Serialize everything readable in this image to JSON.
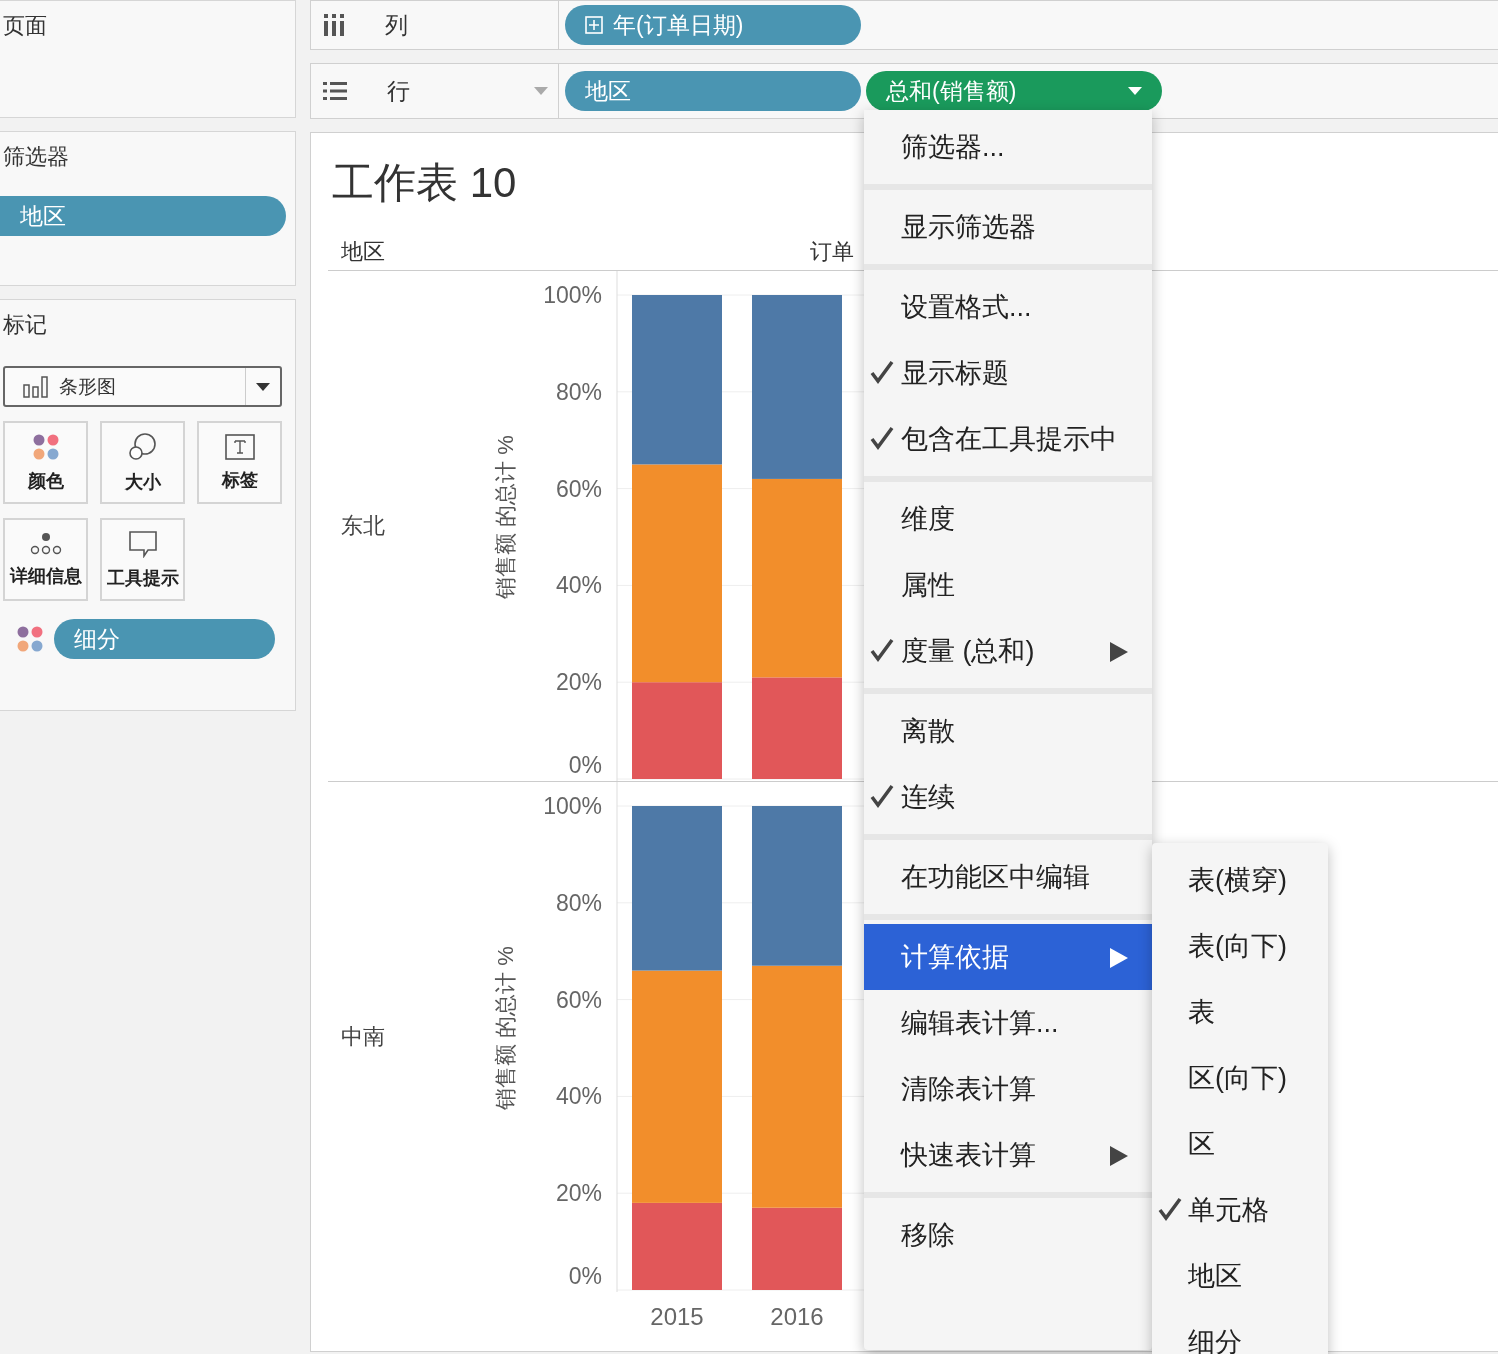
{
  "sidebar": {
    "pages": {
      "title": "页面"
    },
    "filters": {
      "title": "筛选器",
      "pills": [
        "地区"
      ]
    },
    "marks": {
      "title": "标记",
      "mark_type": "条形图",
      "cards": [
        {
          "label": "颜色",
          "kind": "color"
        },
        {
          "label": "大小",
          "kind": "size"
        },
        {
          "label": "标签",
          "kind": "label"
        },
        {
          "label": "详细信息",
          "kind": "detail"
        },
        {
          "label": "工具提示",
          "kind": "tooltip"
        }
      ],
      "fields": [
        {
          "kind": "color",
          "pill": "细分"
        }
      ]
    }
  },
  "shelves": [
    {
      "kind": "columns",
      "label": "列",
      "pills": [
        {
          "text": "年(订单日期)",
          "kind": "dimension",
          "expandable": true
        }
      ]
    },
    {
      "kind": "rows",
      "label": "行",
      "pills": [
        {
          "text": "地区",
          "kind": "dimension",
          "expandable": false
        },
        {
          "text": "总和(销售额)",
          "kind": "measure",
          "expandable": false
        }
      ]
    }
  ],
  "sheet": {
    "title": "工作表 10",
    "headers": [
      "地区",
      "订单"
    ],
    "panes": [
      {
        "region": "东北",
        "chart_data": {
          "type": "bar",
          "stacked": true,
          "ylabel": "销售额 的总计 %",
          "ylim": [
            0,
            1
          ],
          "yticks": [
            {
              "value": 0,
              "label": "0%"
            },
            {
              "value": 0.2,
              "label": "20%"
            },
            {
              "value": 0.4,
              "label": "40%"
            },
            {
              "value": 0.6,
              "label": "60%"
            },
            {
              "value": 0.8,
              "label": "80%"
            },
            {
              "value": 1,
              "label": "100%"
            }
          ],
          "grid": true,
          "series": [
            {
              "color": "#e15759",
              "values": [
                0.2,
                0.21
              ]
            },
            {
              "color": "#f28e2b",
              "values": [
                0.45,
                0.41
              ]
            },
            {
              "color": "#4e79a7",
              "values": [
                0.35,
                0.38
              ]
            }
          ]
        }
      },
      {
        "region": "中南",
        "chart_data": {
          "type": "bar",
          "stacked": true,
          "ylabel": "销售额 的总计 %",
          "categories": [
            "2015",
            "2016"
          ],
          "ylim": [
            0,
            1
          ],
          "yticks": [
            {
              "value": 0,
              "label": "0%"
            },
            {
              "value": 0.2,
              "label": "20%"
            },
            {
              "value": 0.4,
              "label": "40%"
            },
            {
              "value": 0.6,
              "label": "60%"
            },
            {
              "value": 0.8,
              "label": "80%"
            },
            {
              "value": 1,
              "label": "100%"
            }
          ],
          "grid": true,
          "series": [
            {
              "color": "#e15759",
              "values": [
                0.18,
                0.17
              ]
            },
            {
              "color": "#f28e2b",
              "values": [
                0.48,
                0.5
              ]
            },
            {
              "color": "#4e79a7",
              "values": [
                0.34,
                0.33
              ]
            }
          ]
        }
      }
    ]
  },
  "context_menu": {
    "groups": [
      [
        {
          "label": "筛选器...",
          "checked": false,
          "submenu": false,
          "selected": false
        }
      ],
      [
        {
          "label": "显示筛选器",
          "checked": false,
          "submenu": false,
          "selected": false
        }
      ],
      [
        {
          "label": "设置格式...",
          "checked": false,
          "submenu": false,
          "selected": false
        },
        {
          "label": "显示标题",
          "checked": true,
          "submenu": false,
          "selected": false
        },
        {
          "label": "包含在工具提示中",
          "checked": true,
          "submenu": false,
          "selected": false
        }
      ],
      [
        {
          "label": "维度",
          "checked": false,
          "submenu": false,
          "selected": false
        },
        {
          "label": "属性",
          "checked": false,
          "submenu": false,
          "selected": false
        },
        {
          "label": "度量 (总和)",
          "checked": true,
          "submenu": true,
          "selected": false
        }
      ],
      [
        {
          "label": "离散",
          "checked": false,
          "submenu": false,
          "selected": false
        },
        {
          "label": "连续",
          "checked": true,
          "submenu": false,
          "selected": false
        }
      ],
      [
        {
          "label": "在功能区中编辑",
          "checked": false,
          "submenu": false,
          "selected": false
        }
      ],
      [
        {
          "label": "计算依据",
          "checked": false,
          "submenu": true,
          "selected": true
        },
        {
          "label": "编辑表计算...",
          "checked": false,
          "submenu": false,
          "selected": false
        },
        {
          "label": "清除表计算",
          "checked": false,
          "submenu": false,
          "selected": false
        },
        {
          "label": "快速表计算",
          "checked": false,
          "submenu": true,
          "selected": false
        }
      ],
      [
        {
          "label": "移除",
          "checked": false,
          "submenu": false,
          "selected": false
        }
      ]
    ]
  },
  "submenu": {
    "items": [
      {
        "label": "表(横穿)",
        "checked": false
      },
      {
        "label": "表(向下)",
        "checked": false
      },
      {
        "label": "表",
        "checked": false
      },
      {
        "label": "区(向下)",
        "checked": false
      },
      {
        "label": "区",
        "checked": false
      },
      {
        "label": "单元格",
        "checked": true
      },
      {
        "label": "地区",
        "checked": false
      },
      {
        "label": "细分",
        "checked": false
      }
    ]
  }
}
